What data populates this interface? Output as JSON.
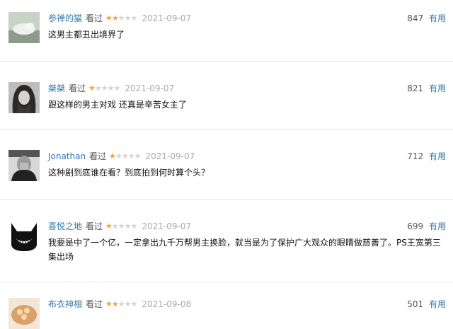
{
  "reviews": [
    {
      "username": "参禅的猫",
      "status": "看过",
      "rating": 2,
      "date": "2021-09-07",
      "votes": "847",
      "useful": "有用",
      "comment": "这男主都丑出境界了",
      "avatar": "cat-photo-avatar"
    },
    {
      "username": "桀桀",
      "status": "看过",
      "rating": 1,
      "date": "2021-09-07",
      "votes": "821",
      "useful": "有用",
      "comment": "跟这样的男主对戏 还真是辛苦女主了",
      "avatar": "woman-portrait-avatar"
    },
    {
      "username": "Jonathan",
      "status": "看过",
      "rating": 1,
      "date": "2021-09-07",
      "votes": "712",
      "useful": "有用",
      "comment": "这种剧到底谁在看？到底拍到何时算个头？",
      "avatar": "man-portrait-avatar"
    },
    {
      "username": "喜悦之地",
      "status": "看过",
      "rating": 1,
      "date": "2021-09-07",
      "votes": "699",
      "useful": "有用",
      "comment": "我要是中了一个亿，一定拿出九千万帮男主换脸，就当是为了保护广大观众的眼睛做慈善了。PS王宽第三集出场",
      "avatar": "grinning-face-avatar"
    },
    {
      "username": "布衣神相",
      "status": "看过",
      "rating": 2,
      "date": "2021-09-08",
      "votes": "501",
      "useful": "有用",
      "comment": "",
      "avatar": "food-bowl-avatar"
    }
  ],
  "colors": {
    "link": "#3377aa",
    "star": "#f4a623",
    "star_empty": "#d4d4d4",
    "date": "#aaaaaa"
  }
}
